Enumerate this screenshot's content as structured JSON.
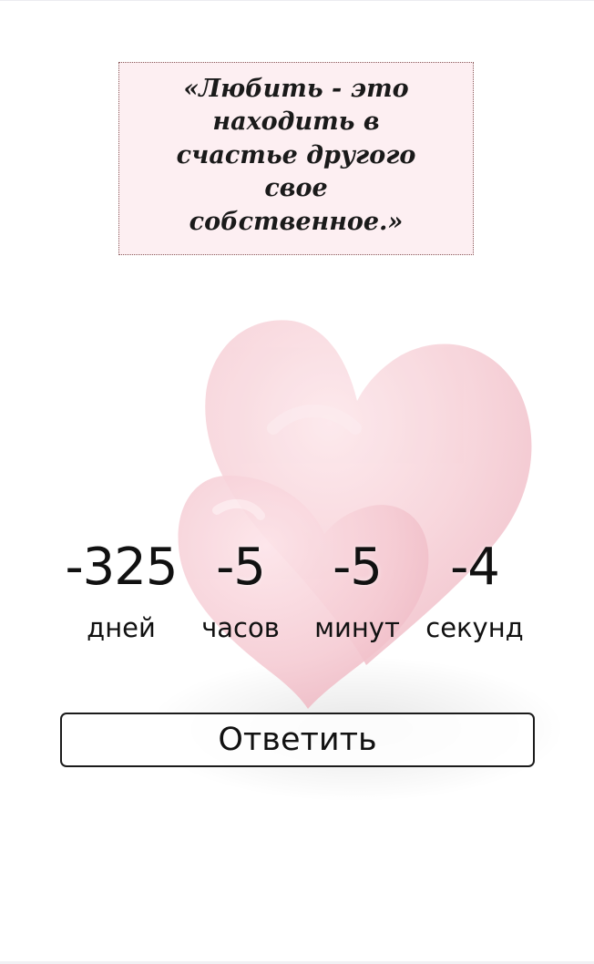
{
  "quote": {
    "text": "«Любить - это находить в счастье другого свое собственное.»"
  },
  "illustration": {
    "icon": "hearts-icon",
    "color": "#f4c6cf"
  },
  "countdown": {
    "days": {
      "value": "-325",
      "label": "дней"
    },
    "hours": {
      "value": "-5",
      "label": "часов"
    },
    "minutes": {
      "value": "-5",
      "label": "минут"
    },
    "seconds": {
      "value": "-4",
      "label": "секунд"
    }
  },
  "reply_button": {
    "label": "Ответить"
  },
  "colors": {
    "quote_background": "#fdeff2",
    "quote_border": "#8a5a5a",
    "text": "#111111"
  }
}
